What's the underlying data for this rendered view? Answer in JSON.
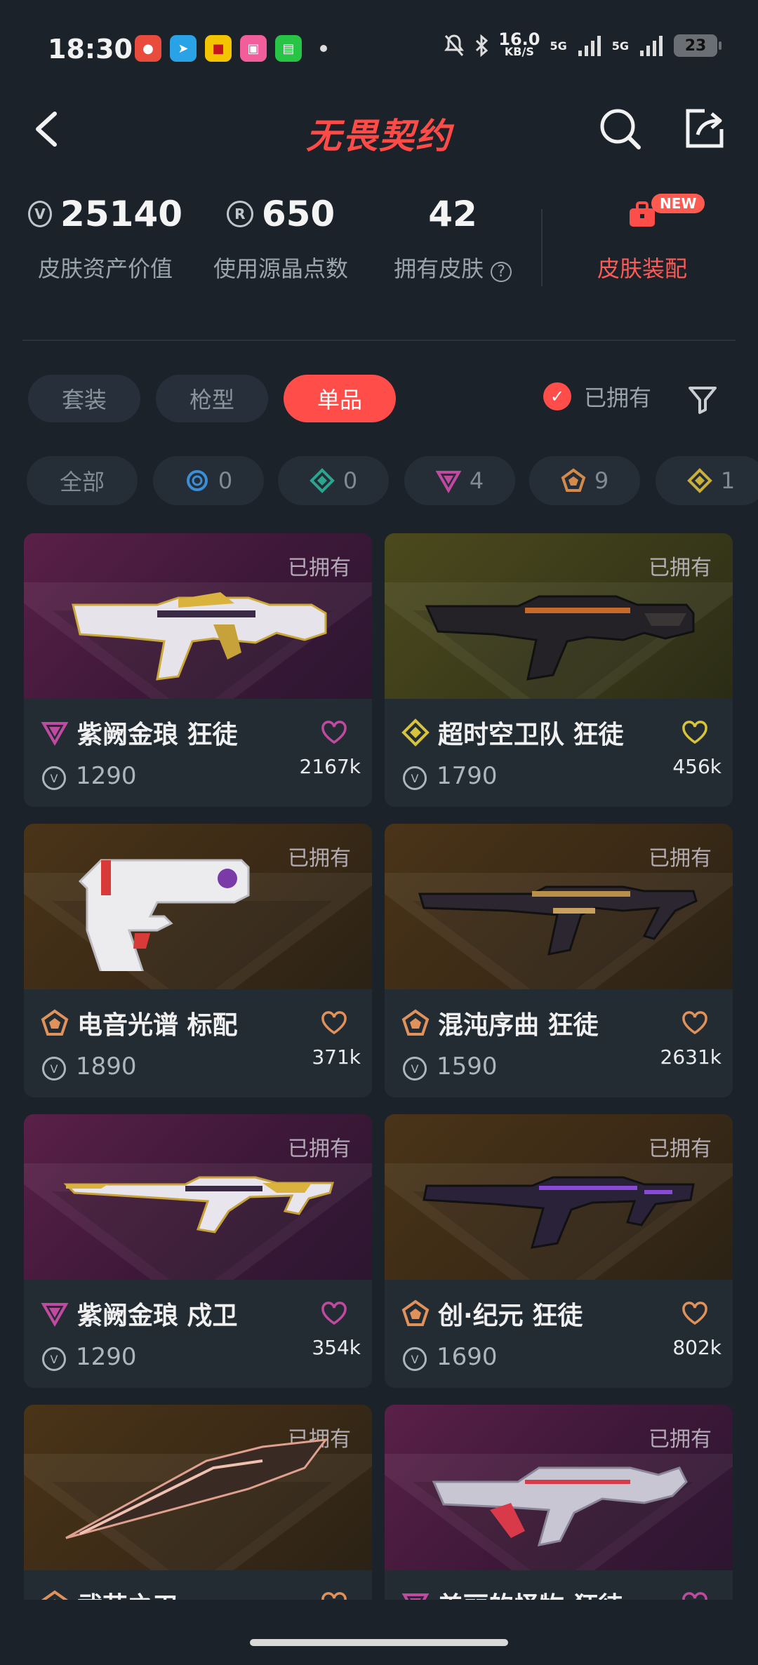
{
  "status_bar": {
    "time": "18:30",
    "speed_value": "16.0",
    "speed_unit": "KB/S",
    "net1": "5G",
    "net2": "5G",
    "battery": "23"
  },
  "header": {
    "title": "无畏契约"
  },
  "stats": {
    "asset_value": "25140",
    "asset_label": "皮肤资产价值",
    "radianite": "650",
    "radianite_label": "使用源晶点数",
    "owned_count": "42",
    "owned_label": "拥有皮肤",
    "loadout_label": "皮肤装配",
    "new_badge": "NEW"
  },
  "tabs": {
    "items": [
      {
        "label": "套装"
      },
      {
        "label": "枪型"
      },
      {
        "label": "单品"
      }
    ],
    "active": "单品",
    "owned_filter": "已拥有"
  },
  "rarity_chips": [
    {
      "label": "全部"
    },
    {
      "icon": "select-tier-icon",
      "count": "0",
      "color": "#3b8ed8"
    },
    {
      "icon": "deluxe-tier-icon",
      "count": "0",
      "color": "#2aa590"
    },
    {
      "icon": "premium-tier-icon",
      "count": "4",
      "color": "#c04aa0"
    },
    {
      "icon": "ultra-tier-icon",
      "count": "9",
      "color": "#d48a4a"
    },
    {
      "icon": "exclusive-tier-icon",
      "count": "1",
      "color": "#c9b038"
    }
  ],
  "owned_tag": "已拥有",
  "skins": [
    {
      "name": "紫阙金琅 狂徒",
      "price": "1290",
      "likes": "2167k",
      "tier": "premium",
      "tier_color": "#c04aa0",
      "bg": "purple"
    },
    {
      "name": "超时空卫队 狂徒",
      "price": "1790",
      "likes": "456k",
      "tier": "exclusive",
      "tier_color": "#d7c43a",
      "bg": "olive"
    },
    {
      "name": "电音光谱 标配",
      "price": "1890",
      "likes": "371k",
      "tier": "ultra",
      "tier_color": "#e0925a",
      "bg": "bronze"
    },
    {
      "name": "混沌序曲 狂徒",
      "price": "1590",
      "likes": "2631k",
      "tier": "ultra",
      "tier_color": "#e0925a",
      "bg": "bronze"
    },
    {
      "name": "紫阙金琅 戍卫",
      "price": "1290",
      "likes": "354k",
      "tier": "premium",
      "tier_color": "#c04aa0",
      "bg": "purple"
    },
    {
      "name": "创·纪元 狂徒",
      "price": "1690",
      "likes": "802k",
      "tier": "ultra",
      "tier_color": "#e0925a",
      "bg": "bronze"
    },
    {
      "name": "武艺之刃",
      "price": "",
      "likes": "",
      "tier": "ultra",
      "tier_color": "#e0925a",
      "bg": "bronze"
    },
    {
      "name": "美丽的怪物 狂徒",
      "price": "",
      "likes": "",
      "tier": "premium",
      "tier_color": "#c04aa0",
      "bg": "purple"
    }
  ]
}
